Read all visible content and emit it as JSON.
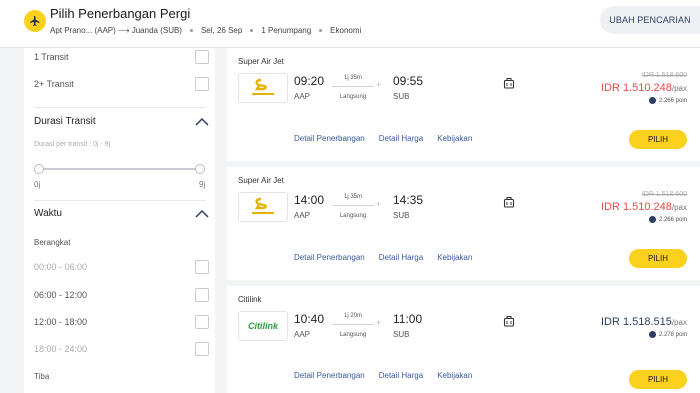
{
  "header": {
    "title": "Pilih Penerbangan Pergi",
    "route": "Apt Prano... (AAP) ⟶ Juanda (SUB)",
    "date": "Sel, 26 Sep",
    "passengers": "1 Penumpang",
    "cabin": "Ekonomi",
    "change_label": "UBAH PENCARIAN",
    "icon": "plane-icon"
  },
  "filter": {
    "transit_options": [
      {
        "label": "1 Transit"
      },
      {
        "label": "2+ Transit"
      }
    ],
    "duration": {
      "title": "Durasi Transit",
      "subtitle": "Durasi per transit : 0j - 9j",
      "min_label": "0j",
      "max_label": "9j"
    },
    "time": {
      "title": "Waktu",
      "depart_label": "Berangkat",
      "slots": [
        {
          "label": "00:00 - 06:00",
          "enabled": false
        },
        {
          "label": "06:00 - 12:00",
          "enabled": true
        },
        {
          "label": "12:00 - 18:00",
          "enabled": true
        },
        {
          "label": "18:00 - 24:00",
          "enabled": false
        }
      ],
      "arrive_label": "Tiba"
    }
  },
  "flights": [
    {
      "airline": "Super Air Jet",
      "logo": "SUPER AIR JET",
      "dep_time": "09:20",
      "dep_code": "AAP",
      "duration": "1j 35m",
      "stops": "Langsung",
      "arr_time": "09:55",
      "arr_code": "SUB",
      "old_price": "IDR 1.518.600",
      "price": "IDR 1.510.248",
      "per": "/pax",
      "points": "2.266 poin",
      "links": [
        "Detail Penerbangan",
        "Detail Harga",
        "Kebijakan"
      ],
      "select_label": "PILIH"
    },
    {
      "airline": "Super Air Jet",
      "logo": "SUPER AIR JET",
      "dep_time": "14:00",
      "dep_code": "AAP",
      "duration": "1j 35m",
      "stops": "Langsung",
      "arr_time": "14:35",
      "arr_code": "SUB",
      "old_price": "IDR 1.518.600",
      "price": "IDR 1.510.248",
      "per": "/pax",
      "points": "2.266 poin",
      "links": [
        "Detail Penerbangan",
        "Detail Harga",
        "Kebijakan"
      ],
      "select_label": "PILIH"
    },
    {
      "airline": "Citilink",
      "logo": "Citilink",
      "dep_time": "10:40",
      "dep_code": "AAP",
      "duration": "1j 20m",
      "stops": "Langsung",
      "arr_time": "11:00",
      "arr_code": "SUB",
      "price": "IDR 1.518.515",
      "per": "/pax",
      "points": "2.278 poin",
      "links": [
        "Detail Penerbangan",
        "Detail Harga",
        "Kebijakan"
      ],
      "select_label": "PILIH"
    }
  ],
  "colors": {
    "accent_yellow": "#fbd11d",
    "price_red": "#e74a4a",
    "navy": "#2d3d63",
    "link_blue": "#3a5a9e",
    "citilink_green": "#2d9c3b"
  }
}
